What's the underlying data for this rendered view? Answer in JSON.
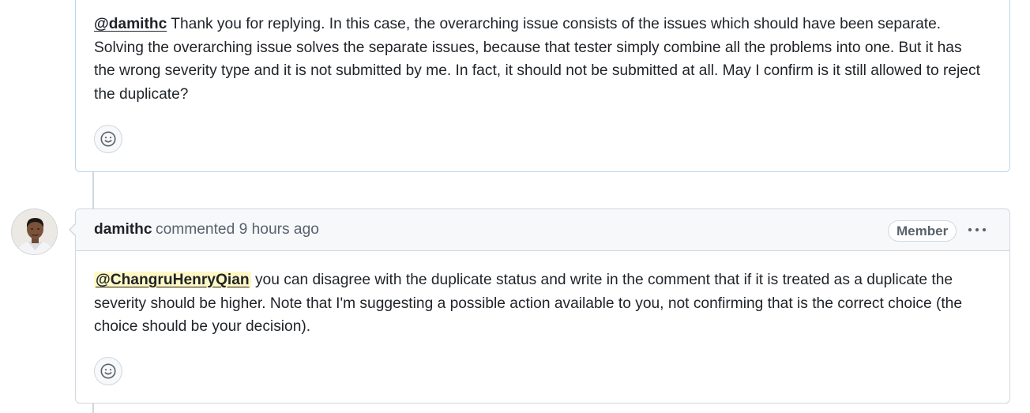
{
  "comments": [
    {
      "mention": "@damithc",
      "text": " Thank you for replying. In this case, the overarching issue consists of the issues which should have been separate. Solving the overarching issue solves the separate issues, because that tester simply combine all the problems into one. But it has the wrong severity type and it is not submitted by me. In fact, it should not be submitted at all. May I confirm is it still allowed to reject the duplicate?",
      "reaction_icon": "smiley-icon"
    },
    {
      "author": "damithc",
      "action": "commented",
      "time": "9 hours ago",
      "badge": "Member",
      "mention": "@ChangruHenryQian",
      "text": " you can disagree with the duplicate status and write in the comment that if it is treated as a duplicate the severity should be higher. Note that I'm suggesting a possible action available to you, not confirming that is the correct choice (the choice should be your decision).",
      "reaction_icon": "smiley-icon",
      "menu_icon": "kebab-icon"
    }
  ],
  "colors": {
    "border": "#d0d7de",
    "highlight_border": "#b6d6ee",
    "header_bg": "#f6f8fa",
    "mention_highlight": "#fff8c5",
    "muted_text": "#59636e"
  }
}
